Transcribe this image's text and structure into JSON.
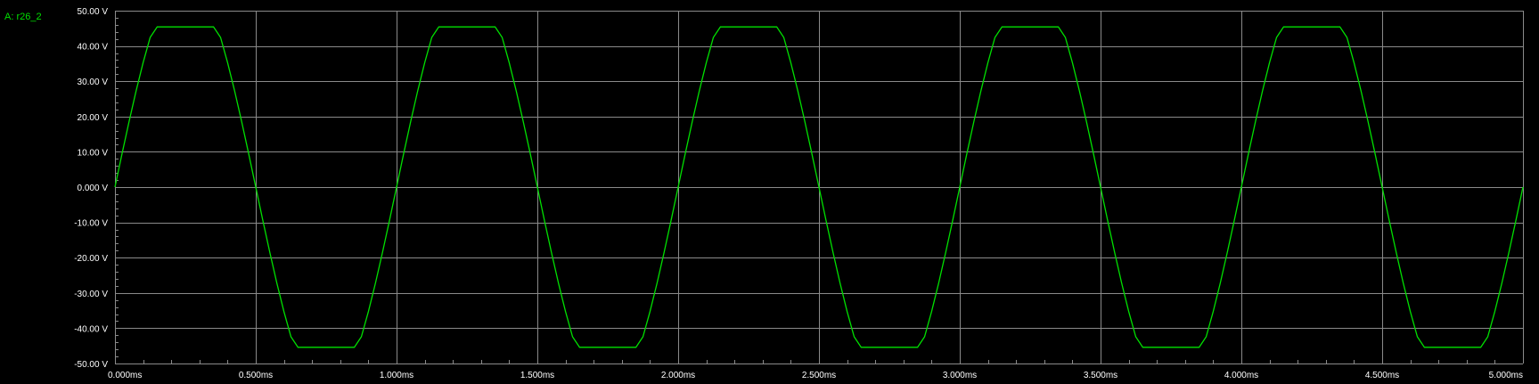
{
  "trace_label": "A: r26_2",
  "colors": {
    "background": "#000000",
    "grid": "#8a8a8a",
    "trace": "#00e000",
    "text": "#ffffff"
  },
  "chart_data": {
    "type": "line",
    "title": "",
    "xlabel": "",
    "ylabel": "",
    "xlim": [
      0,
      5.0
    ],
    "ylim": [
      -50,
      50
    ],
    "grid": true,
    "x_ticks": [
      {
        "value": 0.0,
        "label": "0.000ms"
      },
      {
        "value": 0.5,
        "label": "0.500ms"
      },
      {
        "value": 1.0,
        "label": "1.000ms"
      },
      {
        "value": 1.5,
        "label": "1.500ms"
      },
      {
        "value": 2.0,
        "label": "2.000ms"
      },
      {
        "value": 2.5,
        "label": "2.500ms"
      },
      {
        "value": 3.0,
        "label": "3.000ms"
      },
      {
        "value": 3.5,
        "label": "3.500ms"
      },
      {
        "value": 4.0,
        "label": "4.000ms"
      },
      {
        "value": 4.5,
        "label": "4.500ms"
      },
      {
        "value": 5.0,
        "label": "5.000ms"
      }
    ],
    "y_ticks": [
      {
        "value": 50,
        "label": "50.00 V"
      },
      {
        "value": 40,
        "label": "40.00 V"
      },
      {
        "value": 30,
        "label": "30.00 V"
      },
      {
        "value": 20,
        "label": "20.00 V"
      },
      {
        "value": 10,
        "label": "10.00 V"
      },
      {
        "value": 0,
        "label": "0.000 V"
      },
      {
        "value": -10,
        "label": "-10.00 V"
      },
      {
        "value": -20,
        "label": "-20.00 V"
      },
      {
        "value": -30,
        "label": "-30.00 V"
      },
      {
        "value": -40,
        "label": "-40.00 V"
      },
      {
        "value": -50,
        "label": "-50.00 V"
      }
    ],
    "series": [
      {
        "name": "A: r26_2",
        "x": [
          0.0,
          0.025,
          0.05,
          0.075,
          0.1,
          0.125,
          0.15,
          0.175,
          0.2,
          0.225,
          0.25,
          0.275,
          0.3,
          0.325,
          0.35,
          0.375,
          0.4,
          0.425,
          0.45,
          0.475,
          0.5,
          0.525,
          0.55,
          0.575,
          0.6,
          0.625,
          0.65,
          0.675,
          0.7,
          0.725,
          0.75,
          0.775,
          0.8,
          0.825,
          0.85,
          0.875,
          0.9,
          0.925,
          0.95,
          0.975,
          1.0,
          1.025,
          1.05,
          1.075,
          1.1,
          1.125,
          1.15,
          1.175,
          1.2,
          1.225,
          1.25,
          1.275,
          1.3,
          1.325,
          1.35,
          1.375,
          1.4,
          1.425,
          1.45,
          1.475,
          1.5,
          1.525,
          1.55,
          1.575,
          1.6,
          1.625,
          1.65,
          1.675,
          1.7,
          1.725,
          1.75,
          1.775,
          1.8,
          1.825,
          1.85,
          1.875,
          1.9,
          1.925,
          1.95,
          1.975,
          2.0,
          2.025,
          2.05,
          2.075,
          2.1,
          2.125,
          2.15,
          2.175,
          2.2,
          2.225,
          2.25,
          2.275,
          2.3,
          2.325,
          2.35,
          2.375,
          2.4,
          2.425,
          2.45,
          2.475,
          2.5,
          2.525,
          2.55,
          2.575,
          2.6,
          2.625,
          2.65,
          2.675,
          2.7,
          2.725,
          2.75,
          2.775,
          2.8,
          2.825,
          2.85,
          2.875,
          2.9,
          2.925,
          2.95,
          2.975,
          3.0,
          3.025,
          3.05,
          3.075,
          3.1,
          3.125,
          3.15,
          3.175,
          3.2,
          3.225,
          3.25,
          3.275,
          3.3,
          3.325,
          3.35,
          3.375,
          3.4,
          3.425,
          3.45,
          3.475,
          3.5,
          3.525,
          3.55,
          3.575,
          3.6,
          3.625,
          3.65,
          3.675,
          3.7,
          3.725,
          3.75,
          3.775,
          3.8,
          3.825,
          3.85,
          3.875,
          3.9,
          3.925,
          3.95,
          3.975,
          4.0,
          4.025,
          4.05,
          4.075,
          4.1,
          4.125,
          4.15,
          4.175,
          4.2,
          4.225,
          4.25,
          4.275,
          4.3,
          4.325,
          4.35,
          4.375,
          4.4,
          4.425,
          4.45,
          4.475,
          4.5,
          4.525,
          4.55,
          4.575,
          4.6,
          4.625,
          4.65,
          4.675,
          4.7,
          4.725,
          4.75,
          4.775,
          4.8,
          4.825,
          4.85,
          4.875,
          4.9,
          4.925,
          4.95,
          4.975,
          5.0
        ],
        "y": [
          0.0,
          9.39,
          18.54,
          27.24,
          35.27,
          42.43,
          45.4,
          45.4,
          45.4,
          45.4,
          45.4,
          45.4,
          45.4,
          45.4,
          45.4,
          42.43,
          35.27,
          27.24,
          18.54,
          9.39,
          0.0,
          -9.39,
          -18.54,
          -27.24,
          -35.27,
          -42.43,
          -45.4,
          -45.4,
          -45.4,
          -45.4,
          -45.4,
          -45.4,
          -45.4,
          -45.4,
          -45.4,
          -42.43,
          -35.27,
          -27.24,
          -18.54,
          -9.39,
          0.0,
          9.39,
          18.54,
          27.24,
          35.27,
          42.43,
          45.4,
          45.4,
          45.4,
          45.4,
          45.4,
          45.4,
          45.4,
          45.4,
          45.4,
          42.43,
          35.27,
          27.24,
          18.54,
          9.39,
          0.0,
          -9.39,
          -18.54,
          -27.24,
          -35.27,
          -42.43,
          -45.4,
          -45.4,
          -45.4,
          -45.4,
          -45.4,
          -45.4,
          -45.4,
          -45.4,
          -45.4,
          -42.43,
          -35.27,
          -27.24,
          -18.54,
          -9.39,
          0.0,
          9.39,
          18.54,
          27.24,
          35.27,
          42.43,
          45.4,
          45.4,
          45.4,
          45.4,
          45.4,
          45.4,
          45.4,
          45.4,
          45.4,
          42.43,
          35.27,
          27.24,
          18.54,
          9.39,
          0.0,
          -9.39,
          -18.54,
          -27.24,
          -35.27,
          -42.43,
          -45.4,
          -45.4,
          -45.4,
          -45.4,
          -45.4,
          -45.4,
          -45.4,
          -45.4,
          -45.4,
          -42.43,
          -35.27,
          -27.24,
          -18.54,
          -9.39,
          0.0,
          9.39,
          18.54,
          27.24,
          35.27,
          42.43,
          45.4,
          45.4,
          45.4,
          45.4,
          45.4,
          45.4,
          45.4,
          45.4,
          45.4,
          42.43,
          35.27,
          27.24,
          18.54,
          9.39,
          0.0,
          -9.39,
          -18.54,
          -27.24,
          -35.27,
          -42.43,
          -45.4,
          -45.4,
          -45.4,
          -45.4,
          -45.4,
          -45.4,
          -45.4,
          -45.4,
          -45.4,
          -42.43,
          -35.27,
          -27.24,
          -18.54,
          -9.39,
          0.0,
          9.39,
          18.54,
          27.24,
          35.27,
          42.43,
          45.4,
          45.4,
          45.4,
          45.4,
          45.4,
          45.4,
          45.4,
          45.4,
          45.4,
          42.43,
          35.27,
          27.24,
          18.54,
          9.39,
          0.0,
          -9.39,
          -18.54,
          -27.24,
          -35.27,
          -42.43,
          -45.4,
          -45.4,
          -45.4,
          -45.4,
          -45.4,
          -45.4,
          -45.4,
          -45.4,
          -45.4,
          -42.43,
          -35.27,
          -27.24,
          -18.54,
          -9.39,
          0.0
        ]
      }
    ]
  }
}
